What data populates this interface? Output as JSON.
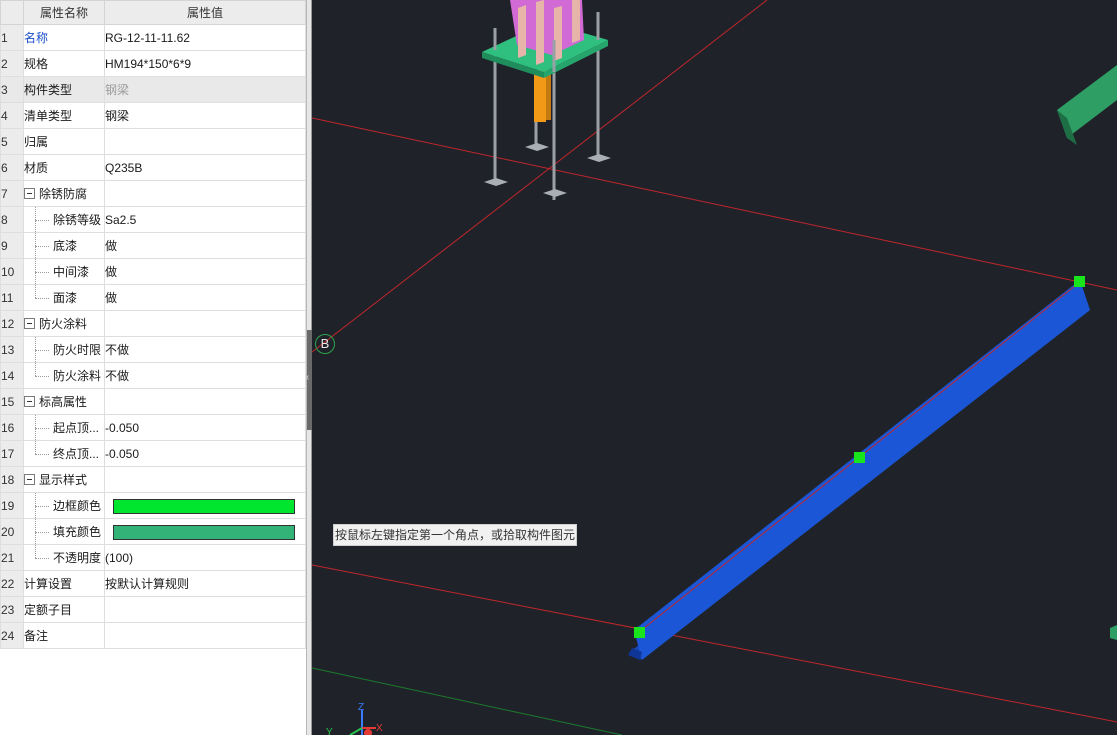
{
  "panel": {
    "header": {
      "name_col": "属性名称",
      "value_col": "属性值"
    },
    "rows": [
      {
        "num": "1",
        "name": "名称",
        "value": "RG-12-11-11.62"
      },
      {
        "num": "2",
        "name": "规格",
        "value": "HM194*150*6*9"
      },
      {
        "num": "3",
        "name": "构件类型",
        "value": "钢梁"
      },
      {
        "num": "4",
        "name": "清单类型",
        "value": "钢梁"
      },
      {
        "num": "5",
        "name": "归属",
        "value": ""
      },
      {
        "num": "6",
        "name": "材质",
        "value": "Q235B"
      },
      {
        "num": "7",
        "name": "除锈防腐",
        "value": ""
      },
      {
        "num": "8",
        "name": "除锈等级",
        "value": "Sa2.5"
      },
      {
        "num": "9",
        "name": "底漆",
        "value": "做"
      },
      {
        "num": "10",
        "name": "中间漆",
        "value": "做"
      },
      {
        "num": "11",
        "name": "面漆",
        "value": "做"
      },
      {
        "num": "12",
        "name": "防火涂料",
        "value": ""
      },
      {
        "num": "13",
        "name": "防火时限",
        "value": "不做"
      },
      {
        "num": "14",
        "name": "防火涂料",
        "value": "不做"
      },
      {
        "num": "15",
        "name": "标高属性",
        "value": ""
      },
      {
        "num": "16",
        "name": "起点顶...",
        "value": "-0.050"
      },
      {
        "num": "17",
        "name": "终点顶...",
        "value": "-0.050"
      },
      {
        "num": "18",
        "name": "显示样式",
        "value": ""
      },
      {
        "num": "19",
        "name": "边框颜色",
        "value": ""
      },
      {
        "num": "20",
        "name": "填充颜色",
        "value": ""
      },
      {
        "num": "21",
        "name": "不透明度",
        "value": "(100)"
      },
      {
        "num": "22",
        "name": "计算设置",
        "value": "按默认计算规则"
      },
      {
        "num": "23",
        "name": "定额子目",
        "value": ""
      },
      {
        "num": "24",
        "name": "备注",
        "value": ""
      }
    ],
    "colors": {
      "border_color": "#00e52e",
      "fill_color": "#33b377"
    }
  },
  "viewport": {
    "status_tip": "按鼠标左键指定第一个角点，或拾取构件图元",
    "axis_label": "B",
    "ucs": {
      "x": "X",
      "y": "Y",
      "z": "Z"
    }
  }
}
